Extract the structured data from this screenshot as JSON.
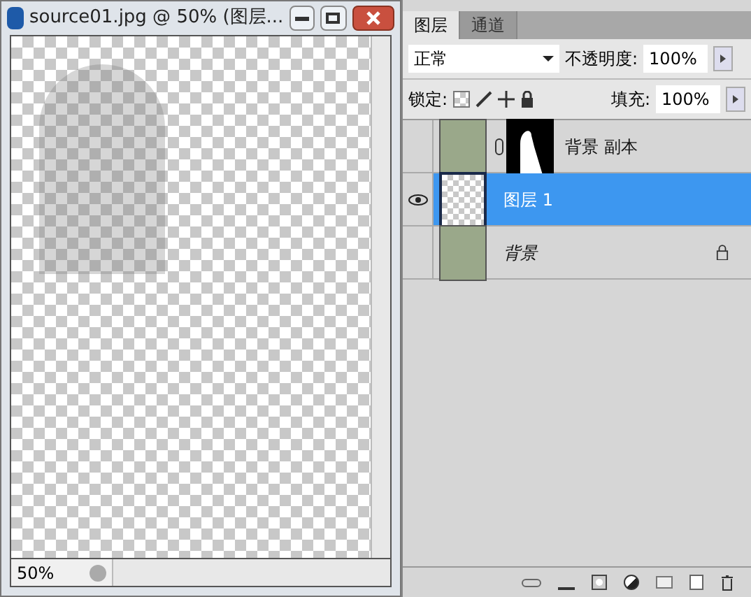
{
  "document_window": {
    "title": "source01.jpg @ 50% (图层...",
    "zoom": "50%"
  },
  "layers_panel": {
    "tabs": [
      {
        "label": "图层",
        "selected": true
      },
      {
        "label": "通道",
        "selected": false
      }
    ],
    "blend_mode": "正常",
    "opacity_label": "不透明度:",
    "opacity": "100%",
    "lock_label": "锁定:",
    "fill_label": "填充:",
    "fill": "100%",
    "layers": [
      {
        "name": "背景 副本",
        "visible": false,
        "selected": false,
        "kind": "masked",
        "locked": false,
        "italic": false
      },
      {
        "name": "图层 1",
        "visible": true,
        "selected": true,
        "kind": "transparent",
        "locked": false,
        "italic": false
      },
      {
        "name": "背景",
        "visible": false,
        "selected": false,
        "kind": "photo",
        "locked": true,
        "italic": true
      }
    ]
  }
}
